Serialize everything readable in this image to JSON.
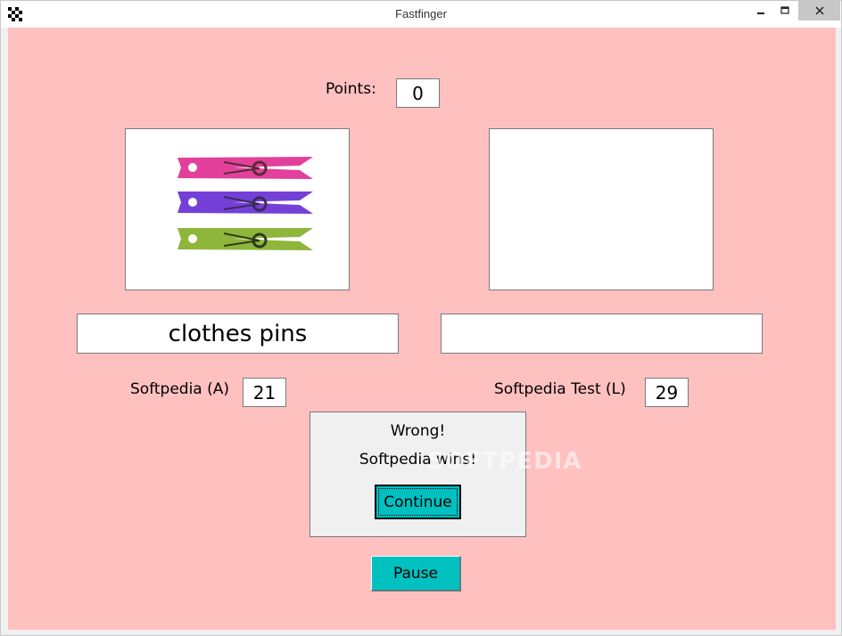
{
  "window": {
    "title": "Fastfinger",
    "app_icon": "checkered-flag-icon",
    "min_icon": "minimize-icon",
    "max_icon": "maximize-icon",
    "close_icon": "close-icon",
    "client_background": "#ffc0c0"
  },
  "game": {
    "points_label": "Points:",
    "points_value": "0",
    "left_image": "clothes-pins-image",
    "left_word": "clothes pins",
    "right_word": "",
    "player_a_label": "Softpedia (A)",
    "player_a_score": "21",
    "player_l_label": "Softpedia Test (L)",
    "player_l_score": "29",
    "pause_label": "Pause",
    "button_color": "#00c0c0"
  },
  "dialog": {
    "line1": "Wrong!",
    "line2": "Softpedia wins!",
    "continue_label": "Continue"
  },
  "watermark": "SOFTPEDIA"
}
